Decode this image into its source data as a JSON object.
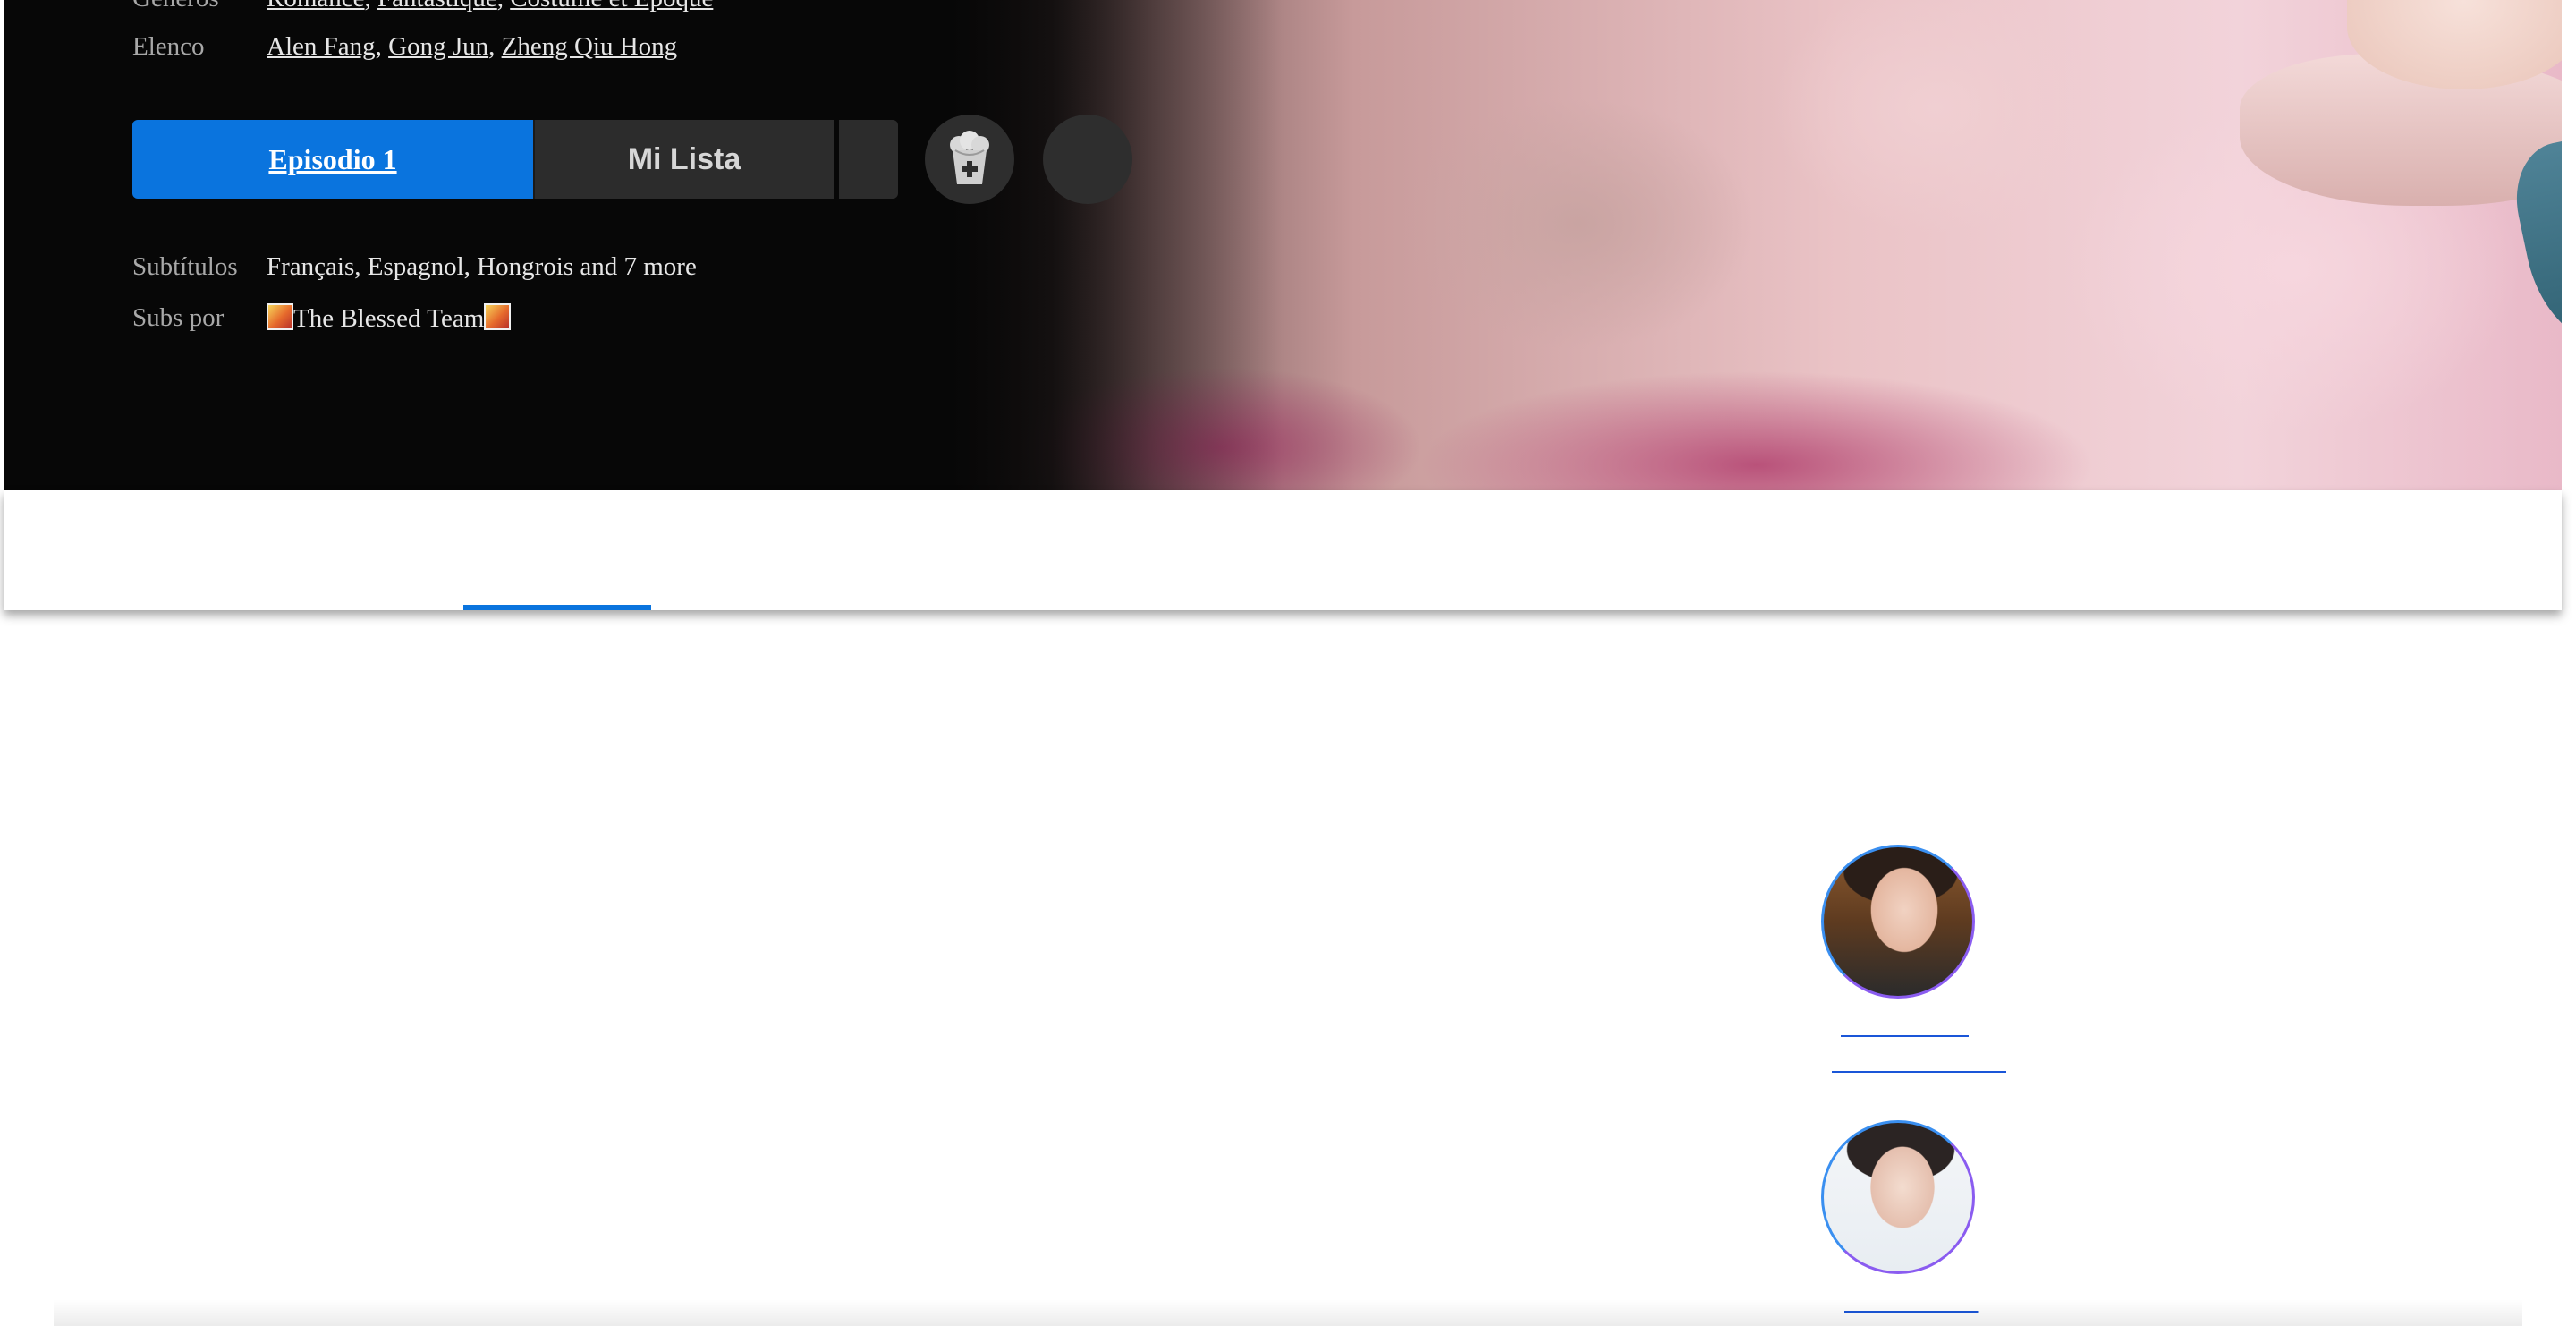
{
  "show": {
    "genres_label": "Géneros",
    "genres": [
      "Romance",
      "Fantastique",
      "Costume et Époque"
    ],
    "cast_label": "Elenco",
    "cast_links": [
      "Alen Fang",
      "Gong Jun",
      "Zheng Qiu Hong"
    ],
    "subtitles_label": "Subtítulos",
    "subtitles_value": "Français, Espagnol, Hongrois and 7 more",
    "subs_by_label": "Subs por",
    "subs_by_value": "The Blessed Team"
  },
  "actions": {
    "episode_label": "Episodio 1",
    "my_list_label": "Mi Lista",
    "more_icon": "more-icon",
    "popcorn_icon": "popcorn-add-icon"
  },
  "colors": {
    "accent": "#0a74de",
    "hero_bg": "#070707",
    "button_dark": "#2c2c2c",
    "link_blue": "#1a56d8"
  }
}
